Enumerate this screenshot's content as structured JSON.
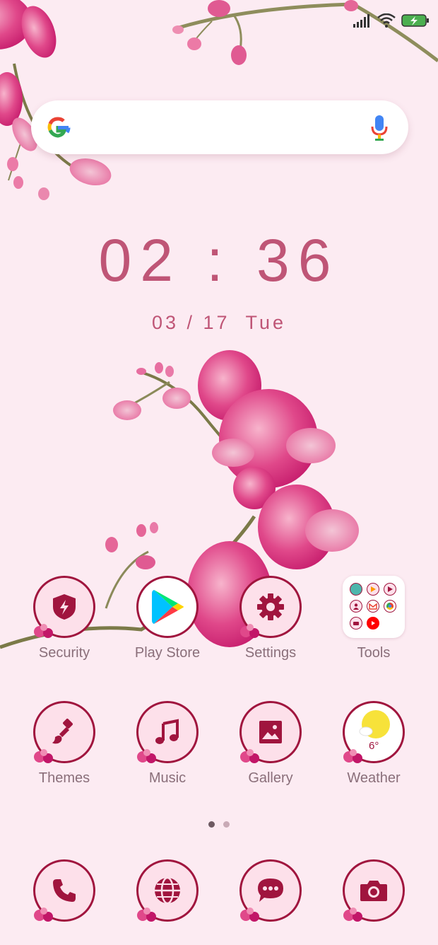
{
  "colors": {
    "accent": "#a0153e",
    "text": "#bf5576",
    "label": "#8a6f7a",
    "background": "#fcebf2"
  },
  "status": {
    "icons": [
      "signal-icon",
      "wifi-icon",
      "battery-charging-icon"
    ]
  },
  "search": {
    "icons": [
      "google-logo",
      "mic-icon"
    ]
  },
  "clock": {
    "time": "02 : 36",
    "date": "03 / 17",
    "weekday": "Tue"
  },
  "apps": {
    "row1": [
      {
        "label": "Security",
        "icon": "shield-icon"
      },
      {
        "label": "Play Store",
        "icon": "play-store-icon"
      },
      {
        "label": "Settings",
        "icon": "gear-icon"
      },
      {
        "label": "Tools",
        "icon": "folder-icon"
      }
    ],
    "row2": [
      {
        "label": "Themes",
        "icon": "brush-icon"
      },
      {
        "label": "Music",
        "icon": "music-note-icon"
      },
      {
        "label": "Gallery",
        "icon": "image-icon"
      },
      {
        "label": "Weather",
        "icon": "sun-icon",
        "badge": "6°"
      }
    ]
  },
  "dock": [
    {
      "icon": "phone-icon"
    },
    {
      "icon": "globe-icon"
    },
    {
      "icon": "message-icon"
    },
    {
      "icon": "camera-icon"
    }
  ],
  "pages": {
    "count": 2,
    "active": 1
  }
}
